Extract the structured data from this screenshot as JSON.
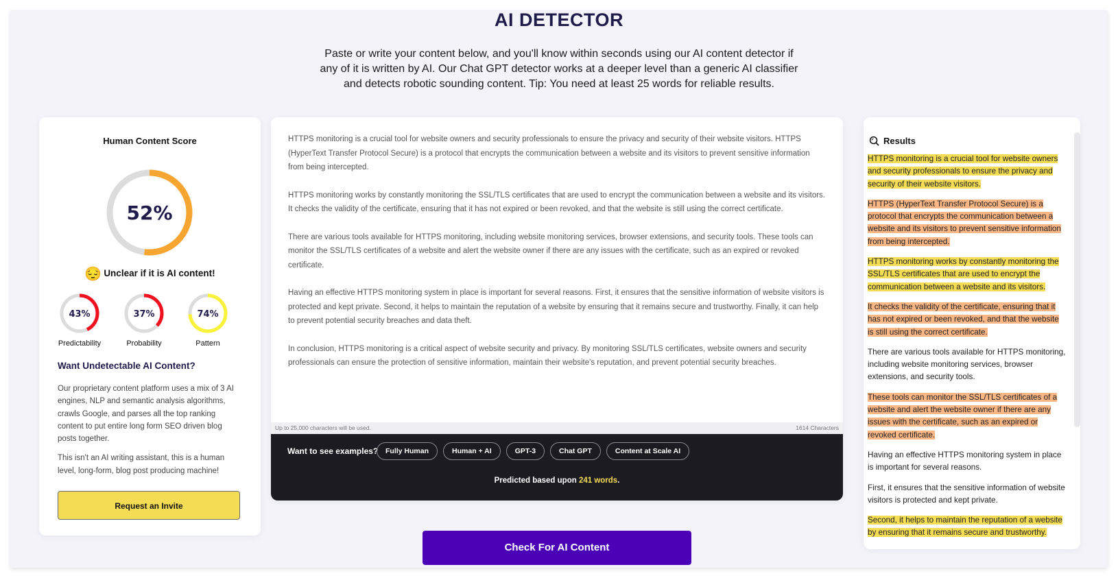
{
  "header": {
    "title": "AI DETECTOR",
    "intro": "Paste or write your content below, and you'll know within seconds using our AI content detector if any of it is written by AI. Our Chat GPT detector works at a deeper level than a generic AI classifier and detects robotic sounding content. Tip: You need at least 25 words for reliable results."
  },
  "score_panel": {
    "heading": "Human Content Score",
    "human_score_percent": 52,
    "human_score_label": "52%",
    "score_color": "#f7a531",
    "verdict_emoji": "😔",
    "verdict": "Unclear if it is AI content!",
    "metrics": [
      {
        "label": "Predictability",
        "percent": 43,
        "value_label": "43%",
        "color": "#f0101e"
      },
      {
        "label": "Probability",
        "percent": 37,
        "value_label": "37%",
        "color": "#f0101e"
      },
      {
        "label": "Pattern",
        "percent": 74,
        "value_label": "74%",
        "color": "#f9f23a"
      }
    ],
    "promo_title": "Want Undetectable AI Content?",
    "promo_paragraphs": [
      "Our proprietary content platform uses a mix of 3 AI engines, NLP and semantic analysis algorithms, crawls Google, and parses all the top ranking content to put entire long form SEO driven blog posts together.",
      "This isn't an AI writing assistant, this is a human level, long-form, blog post producing machine!"
    ],
    "invite_button": "Request an Invite"
  },
  "editor": {
    "paragraphs": [
      "HTTPS monitoring is a crucial tool for website owners and security professionals to ensure the privacy and security of their website visitors. HTTPS (HyperText Transfer Protocol Secure) is a protocol that encrypts the communication between a website and its visitors to prevent sensitive information from being intercepted.",
      "HTTPS monitoring works by constantly monitoring the SSL/TLS certificates that are used to encrypt the communication between a website and its visitors. It checks the validity of the certificate, ensuring that it has not expired or been revoked, and that the website is still using the correct certificate.",
      "There are various tools available for HTTPS monitoring, including website monitoring services, browser extensions, and security tools. These tools can monitor the SSL/TLS certificates of a website and alert the website owner if there are any issues with the certificate, such as an expired or revoked certificate.",
      "Having an effective HTTPS monitoring system in place is important for several reasons. First, it ensures that the sensitive information of website visitors is protected and kept private. Second, it helps to maintain the reputation of a website by ensuring that it remains secure and trustworthy. Finally, it can help to prevent potential security breaches and data theft.",
      "In conclusion, HTTPS monitoring is a critical aspect of website security and privacy. By monitoring SSL/TLS certificates, website owners and security professionals can ensure the protection of sensitive information, maintain their website's reputation, and prevent potential security breaches."
    ],
    "limit_note": "Up to 25,000 characters will be used.",
    "char_count": "1614 Characters",
    "examples_label": "Want to see examples?",
    "example_chips": [
      "Fully Human",
      "Human + AI",
      "GPT-3",
      "Chat GPT",
      "Content at Scale AI"
    ],
    "predicted_prefix": "Predicted based upon ",
    "predicted_words": "241 words",
    "predicted_suffix": "."
  },
  "results": {
    "heading": "Results",
    "highlight_colors": {
      "yellow": "#f5dc55",
      "orange": "#fbb685"
    },
    "sentences": [
      {
        "text": "HTTPS monitoring is a crucial tool for website owners and security professionals to ensure the privacy and security of their website visitors.",
        "highlight": "yellow"
      },
      {
        "text": "HTTPS (HyperText Transfer Protocol Secure) is a protocol that encrypts the communication between a website and its visitors to prevent sensitive information from being intercepted.",
        "highlight": "orange"
      },
      {
        "text": "HTTPS monitoring works by constantly monitoring the SSL/TLS certificates that are used to encrypt the communication between a website and its visitors.",
        "highlight": "yellow"
      },
      {
        "text": "It checks the validity of the certificate, ensuring that it has not expired or been revoked, and that the website is still using the correct certificate.",
        "highlight": "orange"
      },
      {
        "text": "There are various tools available for HTTPS monitoring, including website monitoring services, browser extensions, and security tools.",
        "highlight": "none"
      },
      {
        "text": "These tools can monitor the SSL/TLS certificates of a website and alert the website owner if there are any issues with the certificate, such as an expired or revoked certificate.",
        "highlight": "orange"
      },
      {
        "text": "Having an effective HTTPS monitoring system in place is important for several reasons.",
        "highlight": "none"
      },
      {
        "text": "First, it ensures that the sensitive information of website visitors is protected and kept private.",
        "highlight": "none"
      },
      {
        "text": "Second, it helps to maintain the reputation of a website by ensuring that it remains secure and trustworthy.",
        "highlight": "yellow"
      }
    ]
  },
  "actions": {
    "check_button": "Check For AI Content",
    "check_color": "#4b01b6"
  }
}
